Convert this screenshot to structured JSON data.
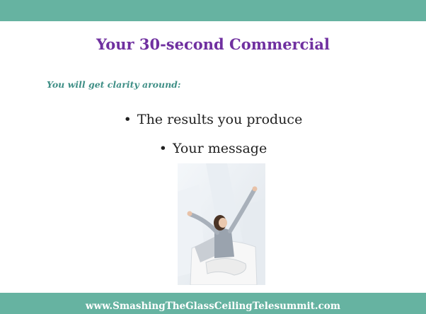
{
  "slide": {
    "title": "Your 30-second Commercial",
    "subtitle": "You will get clarity around:",
    "bullets": [
      "The results you produce",
      "Your message"
    ],
    "bullet_symbol": "•",
    "footer_url": "www.SmashingTheGlassCeilingTelesummit.com"
  },
  "colors": {
    "bar": "#66b3a1",
    "title": "#7030a0",
    "subtitle": "#3f8f86"
  }
}
